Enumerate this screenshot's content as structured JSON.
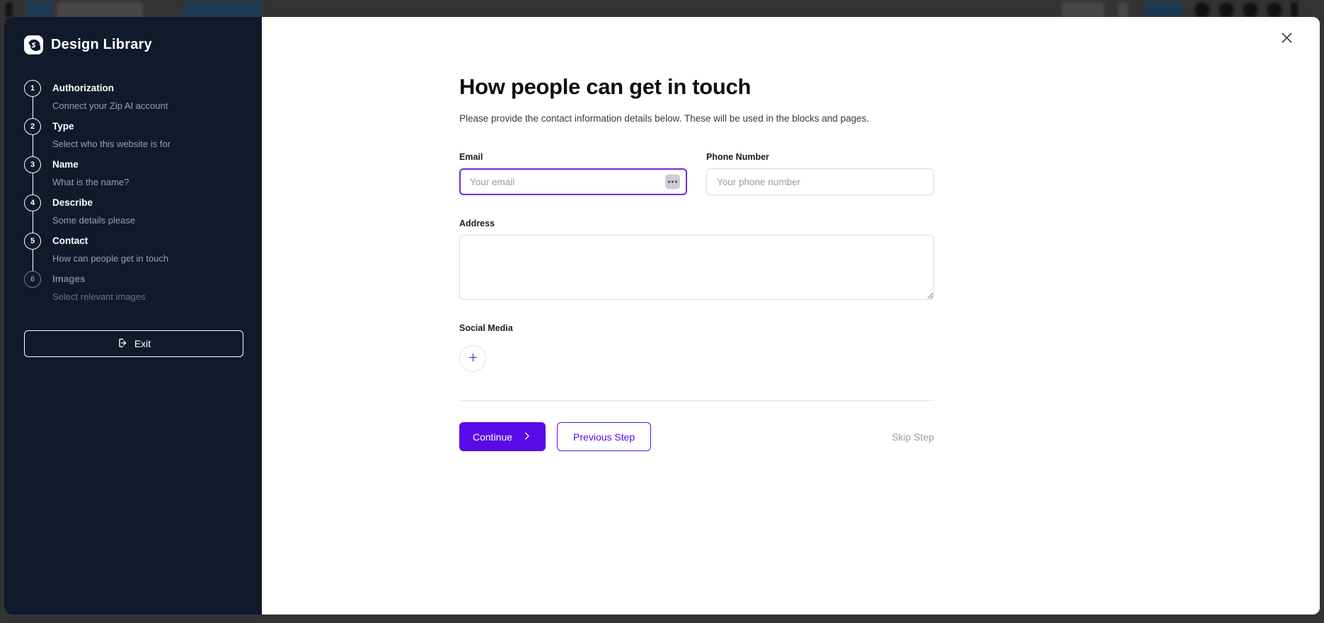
{
  "backdrop": {
    "color": "#333333"
  },
  "modal": {
    "close_icon": "close-icon"
  },
  "sidebar": {
    "brand_title": "Design Library",
    "brand_logo_icon": "shopify-logo-icon",
    "steps": [
      {
        "number": "1",
        "title": "Authorization",
        "desc": "Connect your Zip AI account",
        "state": "active"
      },
      {
        "number": "2",
        "title": "Type",
        "desc": "Select who this website is for",
        "state": "active"
      },
      {
        "number": "3",
        "title": "Name",
        "desc": "What is the name?",
        "state": "active"
      },
      {
        "number": "4",
        "title": "Describe",
        "desc": "Some details please",
        "state": "active"
      },
      {
        "number": "5",
        "title": "Contact",
        "desc": "How can people get in touch",
        "state": "active"
      },
      {
        "number": "6",
        "title": "Images",
        "desc": "Select relevant images",
        "state": "disabled"
      }
    ],
    "exit_label": "Exit",
    "exit_icon": "logout-icon",
    "background": "#111a2b"
  },
  "main": {
    "title": "How people can get in touch",
    "subtitle": "Please provide the contact information details below. These will be used in the blocks and pages.",
    "fields": {
      "email": {
        "label": "Email",
        "placeholder": "Your email",
        "value": "",
        "focused": true,
        "action_icon": "ellipsis-icon"
      },
      "phone": {
        "label": "Phone Number",
        "placeholder": "Your phone number",
        "value": ""
      },
      "address": {
        "label": "Address",
        "placeholder": "",
        "value": ""
      },
      "social": {
        "label": "Social Media",
        "add_icon": "plus-icon"
      }
    },
    "actions": {
      "continue_label": "Continue",
      "continue_icon": "chevron-right-icon",
      "previous_label": "Previous Step",
      "skip_label": "Skip Step"
    },
    "accent_color": "#5a0ae8",
    "focus_color": "#6f2bd6"
  }
}
